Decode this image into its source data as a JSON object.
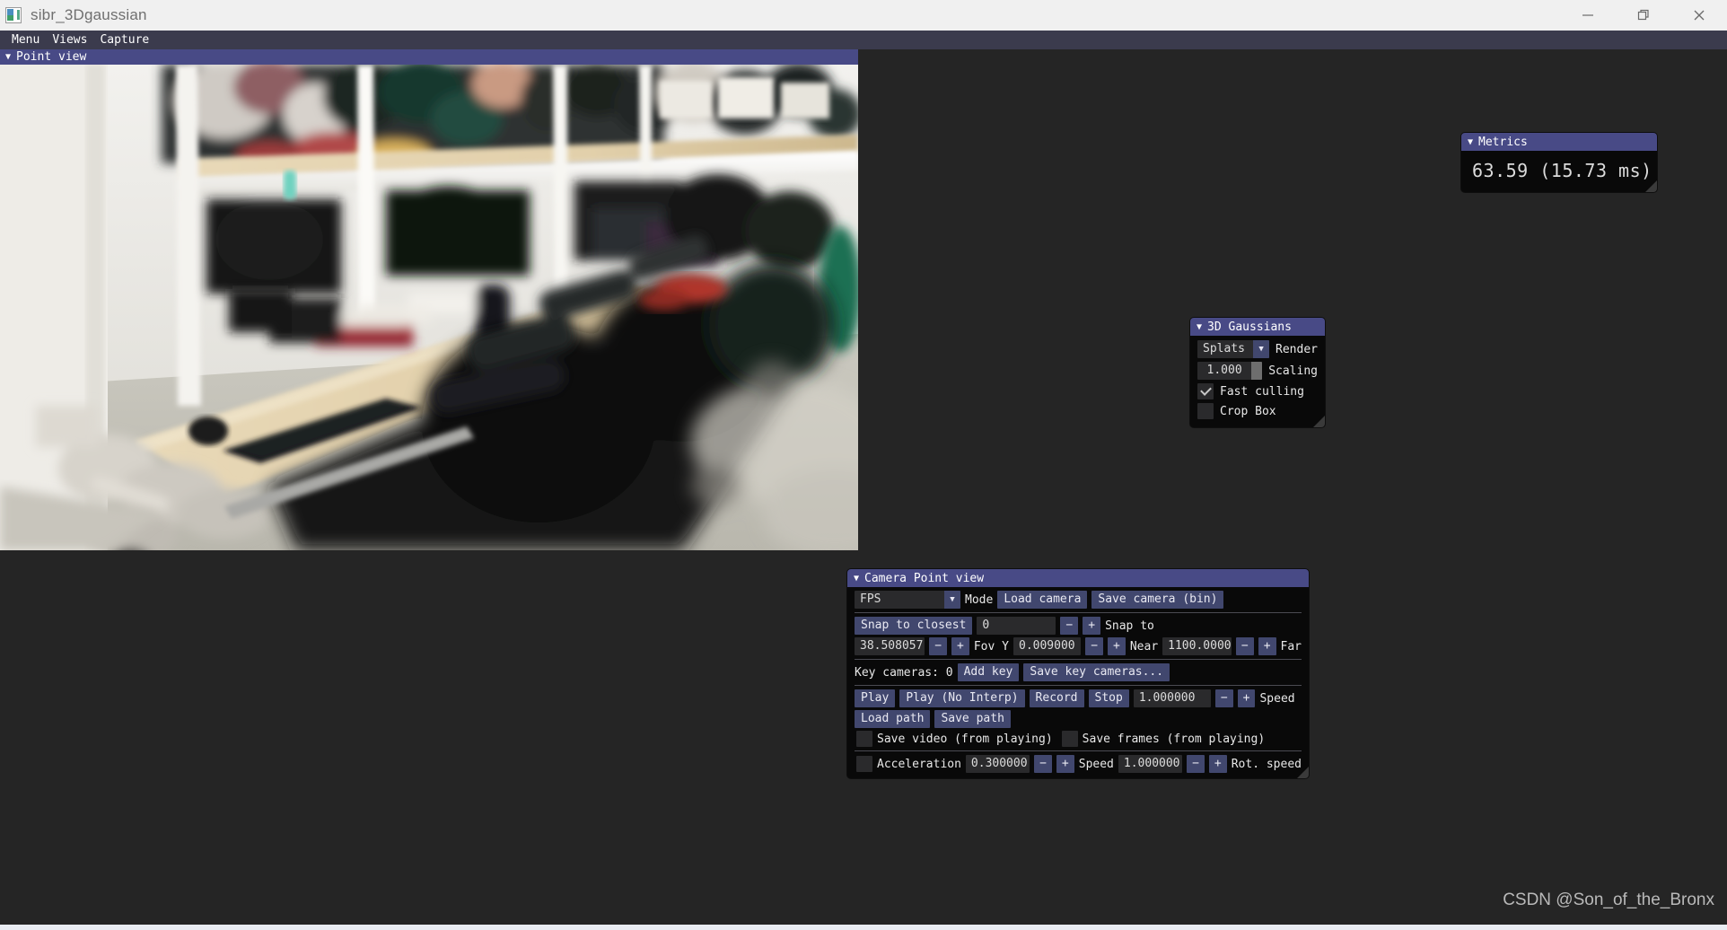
{
  "window": {
    "title": "sibr_3Dgaussian",
    "icon": "image-thumbnail-icon",
    "minimize_label": "—",
    "restore_label": "❐",
    "close_label": "✕"
  },
  "menubar": {
    "items": [
      {
        "label": "Menu"
      },
      {
        "label": "Views"
      },
      {
        "label": "Capture"
      }
    ]
  },
  "viewport": {
    "title": "Point view",
    "caret": "▼",
    "scene_description": "3D Gaussian Splatting render of a laboratory office interior with white shelving, desks, keyboards, monitors and black office chairs"
  },
  "metrics_panel": {
    "caret": "▼",
    "title": "Metrics",
    "value": "63.59 (15.73 ms)",
    "fps": "63.59",
    "frame_time_ms": "15.73"
  },
  "gaussians_panel": {
    "caret": "▼",
    "title": "3D Gaussians",
    "render_mode": {
      "value": "Splats",
      "arrow": "▼",
      "label": "Render"
    },
    "scaling": {
      "value": "1.000",
      "label": "Scaling"
    },
    "fast_culling": {
      "label": "Fast culling",
      "checked": true
    },
    "crop_box": {
      "label": "Crop Box",
      "checked": false
    }
  },
  "camera_panel": {
    "caret": "▼",
    "title": "Camera Point view",
    "mode": {
      "value": "FPS",
      "arrow": "▼",
      "label": "Mode"
    },
    "load_camera": "Load camera",
    "save_camera_bin": "Save camera (bin)",
    "snap_to_closest": "Snap to closest",
    "snap_index": "0",
    "snap_to_label": "Snap to",
    "minus": "−",
    "plus": "+",
    "fovy_value": "38.508057",
    "fovy_label": "Fov Y",
    "near_value": "0.009000",
    "near_label": "Near",
    "far_value": "1100.000000",
    "far_label": "Far",
    "key_cameras_label": "Key cameras: 0",
    "add_key": "Add key",
    "save_key_cameras": "Save key cameras...",
    "play": "Play",
    "play_no_interp": "Play (No Interp)",
    "record": "Record",
    "stop": "Stop",
    "speed_value": "1.000000",
    "speed_label": "Speed",
    "load_path": "Load path",
    "save_path": "Save path",
    "save_video_label": "Save video (from playing)",
    "save_video_checked": false,
    "save_frames_label": "Save frames (from playing)",
    "save_frames_checked": false,
    "acceleration_checked": false,
    "acceleration_label": "Acceleration",
    "acceleration_value": "0.300000",
    "rot_speed_value": "1.000000",
    "rot_speed_label_mid": "Speed",
    "rot_speed_label": "Rot. speed"
  },
  "watermark": {
    "text": "CSDN @Son_of_the_Bronx"
  },
  "colors": {
    "panel_header": "#484a86",
    "button": "#41476e",
    "field": "#2a2a2c",
    "app_background": "#252525",
    "titlebar": "#f0f0f0",
    "menubar": "#3b3b4d"
  }
}
